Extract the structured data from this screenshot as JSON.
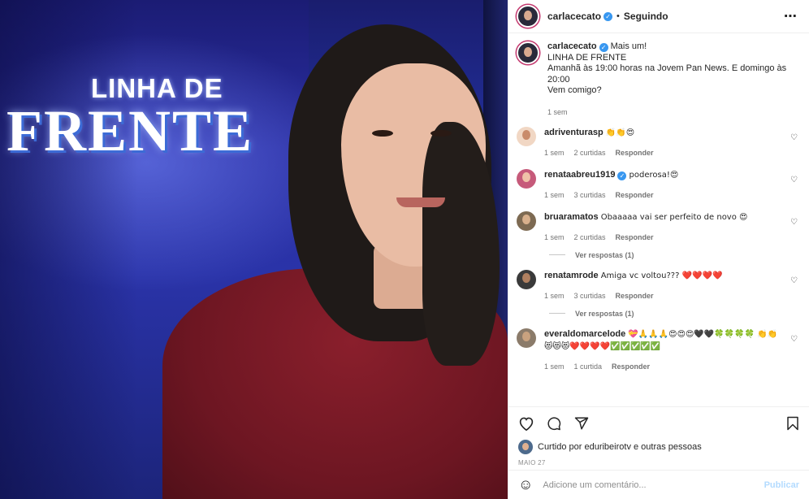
{
  "media": {
    "brand_line1": "LINHA DE",
    "brand_line2": "FRENTE"
  },
  "header": {
    "username": "carlacecato",
    "separator": "•",
    "follow_status": "Seguindo",
    "more_icon": "⋯"
  },
  "caption": {
    "username": "carlacecato",
    "lines": [
      "Mais um!",
      "LINHA DE FRENTE",
      "Amanhã às 19:00 horas na Jovem Pan News. E domingo às 20:00",
      "Vem comigo?"
    ],
    "time": "1 sem"
  },
  "comments": [
    {
      "username": "adriventurasp",
      "verified": false,
      "text": "👏👏😍",
      "time": "1 sem",
      "likes": "2 curtidas",
      "reply": "Responder",
      "view_replies": ""
    },
    {
      "username": "renataabreu1919",
      "verified": true,
      "text": "poderosa!😍",
      "time": "1 sem",
      "likes": "3 curtidas",
      "reply": "Responder",
      "view_replies": ""
    },
    {
      "username": "bruaramatos",
      "verified": false,
      "text": "Obaaaaa vai ser perfeito de novo 😍",
      "time": "1 sem",
      "likes": "2 curtidas",
      "reply": "Responder",
      "view_replies": "Ver respostas (1)"
    },
    {
      "username": "renatamrode",
      "verified": false,
      "text": "Amiga vc voltou??? ❤️❤️❤️❤️",
      "time": "1 sem",
      "likes": "3 curtidas",
      "reply": "Responder",
      "view_replies": "Ver respostas (1)"
    },
    {
      "username": "everaldomarcelode",
      "verified": false,
      "text": "💝🙏🙏🙏😍😍😍🖤🖤🍀🍀🍀🍀 👏👏😻😻😻❤️❤️❤️❤️✅✅✅✅✅",
      "time": "1 sem",
      "likes": "1 curtida",
      "reply": "Responder",
      "view_replies": ""
    }
  ],
  "actions": {
    "like_icon": "heart-icon",
    "comment_icon": "comment-icon",
    "share_icon": "share-icon",
    "save_icon": "bookmark-icon",
    "liked_by": "Curtido por eduribeirotv e outras pessoas",
    "date": "MAIO 27"
  },
  "add_comment": {
    "placeholder": "Adicione um comentário...",
    "publish": "Publicar"
  },
  "colors": {
    "verified": "#3897f0",
    "publish_disabled": "#b3dbff",
    "muted": "#737373"
  }
}
